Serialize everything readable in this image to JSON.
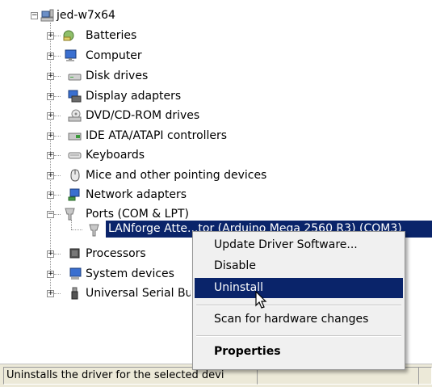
{
  "tree": {
    "root": {
      "label": "jed-w7x64",
      "icon": "computer-root-icon"
    },
    "categories": [
      {
        "label": "Batteries",
        "icon": "battery-icon"
      },
      {
        "label": "Computer",
        "icon": "monitor-icon"
      },
      {
        "label": "Disk drives",
        "icon": "disk-drive-icon"
      },
      {
        "label": "Display adapters",
        "icon": "display-adapter-icon"
      },
      {
        "label": "DVD/CD-ROM drives",
        "icon": "dvd-drive-icon"
      },
      {
        "label": "IDE ATA/ATAPI controllers",
        "icon": "ide-controller-icon"
      },
      {
        "label": "Keyboards",
        "icon": "keyboard-icon"
      },
      {
        "label": "Mice and other pointing devices",
        "icon": "mouse-icon"
      },
      {
        "label": "Network adapters",
        "icon": "network-adapter-icon"
      },
      {
        "label": "Ports (COM & LPT)",
        "icon": "port-icon"
      },
      {
        "label": "Processors",
        "icon": "processor-icon"
      },
      {
        "label": "System devices",
        "icon": "system-devices-icon"
      },
      {
        "label": "Universal Serial Bu",
        "icon": "usb-icon"
      }
    ],
    "selected_device": {
      "label": "LANforge Atte...tor (Arduino Mega 2560 R3) (COM3)",
      "icon": "port-device-icon"
    }
  },
  "context_menu": {
    "items": [
      {
        "label": "Update Driver Software..."
      },
      {
        "label": "Disable"
      },
      {
        "label": "Uninstall"
      },
      {
        "label": "Scan for hardware changes"
      },
      {
        "label": "Properties"
      }
    ]
  },
  "statusbar": {
    "text": "Uninstalls the driver for the selected devi"
  },
  "colors": {
    "selection": "#0a246a",
    "menu_bg": "#f0f0f0"
  }
}
